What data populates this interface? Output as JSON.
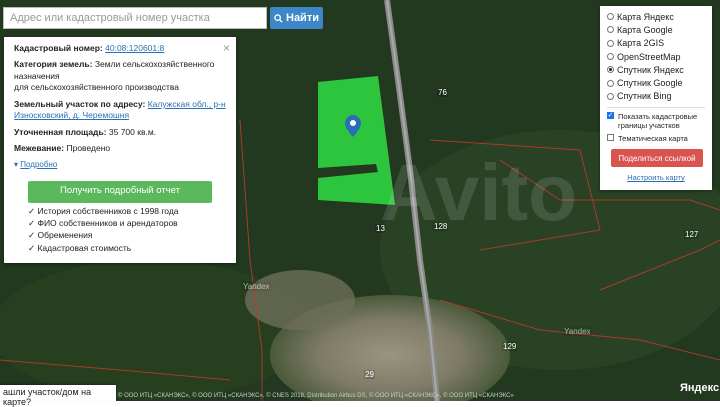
{
  "search": {
    "placeholder": "Адрес или кадастровый номер участка",
    "button_label": "Найти"
  },
  "info": {
    "cadastral_label": "Кадастровый номер:",
    "cadastral_value": "40:08:120601:8",
    "category_label": "Категория земель:",
    "category_value": "Земли сельскохозяйственного назначения",
    "category_value2": "для сельскохозяйственного производства",
    "address_label": "Земельный участок по адресу:",
    "address_value": "Калужская обл., р-н Износковский, д. Черемошня",
    "area_label": "Уточненная площадь:",
    "area_value": "35 700 кв.м.",
    "survey_label": "Межевание:",
    "survey_value": "Проведено",
    "more_link": "Подробно",
    "report_button": "Получить подробный отчет",
    "features": [
      "История собственников с 1998 года",
      "ФИО собственников и арендаторов",
      "Обременения",
      "Кадастровая стоимость"
    ]
  },
  "layers": {
    "options": [
      {
        "label": "Карта Яндекс",
        "selected": false
      },
      {
        "label": "Карта Google",
        "selected": false
      },
      {
        "label": "Карта 2GIS",
        "selected": false
      },
      {
        "label": "OpenStreetMap",
        "selected": false
      },
      {
        "label": "Спутник Яндекс",
        "selected": true
      },
      {
        "label": "Спутник Google",
        "selected": false
      },
      {
        "label": "Спутник Bing",
        "selected": false
      }
    ],
    "show_boundaries": "Показать кадастровые границы участков",
    "thematic": "Тематическая карта",
    "share_button": "Поделиться ссылкой",
    "configure_link": "Настроить карту"
  },
  "map": {
    "labels": [
      "76",
      "13",
      "128",
      "127",
      "129",
      "29",
      "Yandex",
      "Yandex"
    ],
    "road_color": "#8a8a8a",
    "parcel_color": "#2ecc40",
    "marker_color": "#2a6fb5",
    "watermark": "Avito"
  },
  "bottom_question": "ашли участок/дом на карте?",
  "copyright": "© ООО ИТЦ «СКАНЭКС», © ООО ИТЦ «СКАНЭКС», © CNES 2018, Distribution Airbus DS, © ООО ИТЦ «СКАНЭКС», © ООО ИТЦ «СКАНЭКС»",
  "yandex_logo": "Яндекс"
}
